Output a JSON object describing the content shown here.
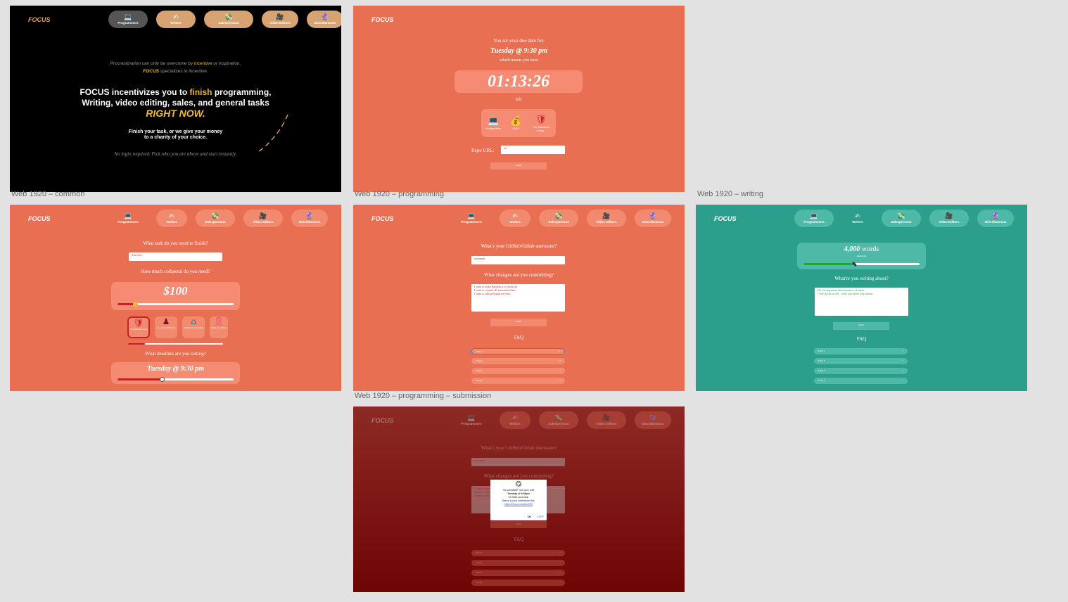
{
  "labels": {
    "common": "Web 1920 – common",
    "programming": "Web 1920 – programming",
    "writing": "Web 1920 – writing",
    "submission": "Web 1920 – programming – submission"
  },
  "brand": "FOCUS",
  "nav": [
    {
      "label": "Programmers",
      "icon": "laptop-icon",
      "glyph": "💻"
    },
    {
      "label": "Writers",
      "icon": "pencil-hand-icon",
      "glyph": "✍"
    },
    {
      "label": "Salespersons",
      "icon": "money-icon",
      "glyph": "💸"
    },
    {
      "label": "Video Editors",
      "icon": "camera-icon",
      "glyph": "🎥"
    },
    {
      "label": "Miscellaneous",
      "icon": "crystal-ball-icon",
      "glyph": "🔮"
    }
  ],
  "landing": {
    "line1_pre": "Procrastination can only be overcome by ",
    "line1_hl": "incentive",
    "line1_post": " or inspiration.",
    "line2_brand": "FOCUS",
    "line2_rest": " specializes in incentive.",
    "head_pre": "FOCUS incentivizes you to ",
    "head_hl": "finish",
    "head_post": " programming,",
    "head2": "Writing, video editing, sales, and general tasks",
    "right_now": "RIGHT NOW.",
    "sub1": "Finish your task, or we give your money",
    "sub2": "to a charity of your choice.",
    "note": "No login required. Pick who you are above and start instantly."
  },
  "countdown": {
    "due_intro": "You set your due date for:",
    "due_date": "Tuesday @ 9:30 pm",
    "means": "which means you have",
    "timer": "01:13:26",
    "left": "left.",
    "chips": [
      {
        "icon": "laptop-icon",
        "glyph": "💻",
        "label": "Programmer"
      },
      {
        "icon": "money-bag-icon",
        "glyph": "💰",
        "label": "$100"
      },
      {
        "icon": "salvation-army-icon",
        "glyph": "🛡",
        "label": "The Salvation Army"
      }
    ],
    "repo_label": "Repo URL:",
    "repo_placeholder": "url"
  },
  "task": {
    "q1": "What task do you need to finish?",
    "q1_value": "Task desc",
    "q2": "How much collateral do you need?",
    "amount": "$100",
    "amount_level": 0.15,
    "charities": [
      "The Salvation Army",
      "St. Jude Children's",
      "Habitat for Humanity",
      "Susan G. Komen"
    ],
    "q3": "What deadline are you setting?",
    "deadline": "Tuesday @ 9:30 pm",
    "deadline_level": 0.38
  },
  "programming": {
    "q1": "What's your GitHub/Gitlab username?",
    "q1_value": "username",
    "q2": "What changes are you committing?",
    "changes": [
      "I want to make Random.x to seeds/rpc",
      "I want to commit all associated class",
      "I want to add gold gain on entry"
    ],
    "submit": "submit",
    "faq": "FAQ",
    "faq_items": [
      "FAQ 1",
      "FAQ 2",
      "FAQ 3",
      "FAQ 4"
    ]
  },
  "writing": {
    "words": "4,000",
    "words_unit": "words",
    "words_sub": "minimum",
    "words_level": 0.45,
    "question": "What're you writing about?",
    "lines": [
      "I'm writing about the economics of onion",
      "I can't focus on the ...well, you know why onions"
    ],
    "submit": "submit",
    "faq": "FAQ",
    "faq_items": [
      "FAQ 1",
      "FAQ 2",
      "FAQ 3",
      "FAQ 4"
    ]
  },
  "dialog": {
    "emoji": "😋",
    "l1": "It's submitted! You have until",
    "l2": "Tuesday @ 9:30pm",
    "l3": "To finish your task.",
    "l4": "Below is your submission link",
    "link": "https://focus.com/abc0fe5",
    "ok": "OK",
    "copy": "COPY"
  },
  "colors": {
    "landing_bg": "#000000",
    "coral": "#e86f52",
    "teal": "#2b9e8c",
    "dark_red": "#7b1414",
    "gold": "#f0b92b"
  }
}
